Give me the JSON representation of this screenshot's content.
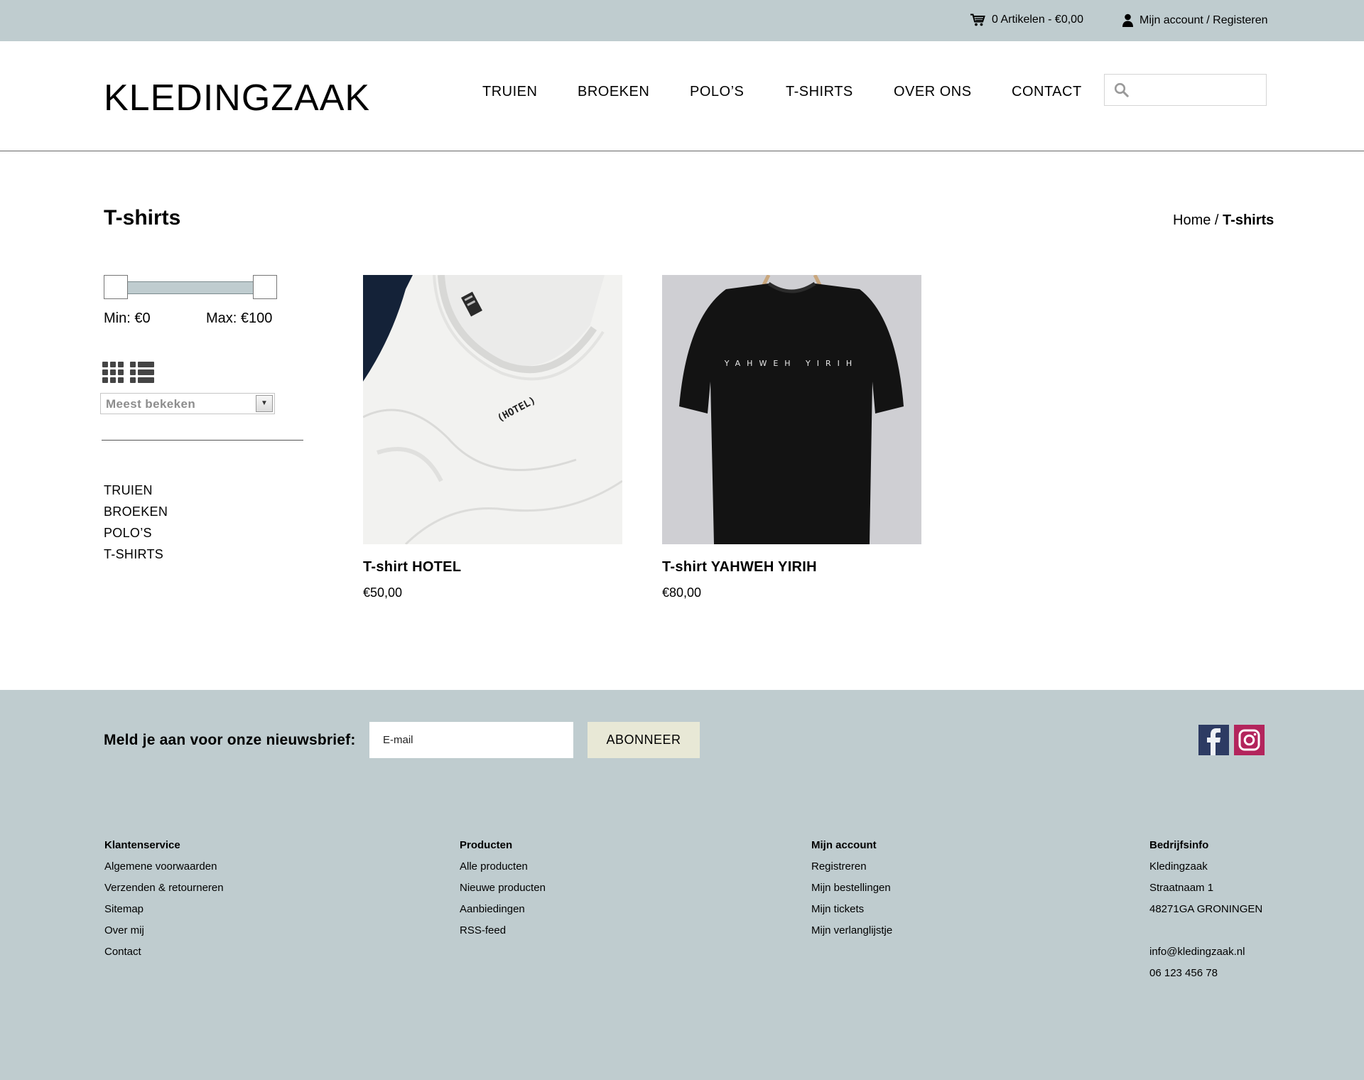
{
  "topbar": {
    "cart_label": "0 Artikelen - €0,00",
    "account_label": "Mijn account / Registeren"
  },
  "header": {
    "logo": "KLEDINGZAAK",
    "nav": [
      "TRUIEN",
      "BROEKEN",
      "POLO’S",
      "T-SHIRTS",
      "OVER ONS",
      "CONTACT"
    ],
    "search_value": ""
  },
  "page": {
    "title": "T-shirts",
    "breadcrumb": {
      "home": "Home",
      "separator": "/",
      "current": "T-shirts"
    }
  },
  "filters": {
    "price": {
      "min_label": "Min: €0",
      "max_label": "Max: €100",
      "min_value": 0,
      "max_value": 100
    },
    "sort": {
      "selected": "Meest bekeken"
    },
    "categories": [
      "TRUIEN",
      "BROEKEN",
      "POLO’S",
      "T-SHIRTS"
    ]
  },
  "products": [
    {
      "name": "T-shirt HOTEL",
      "price": "€50,00",
      "print": "(HOTEL)"
    },
    {
      "name": "T-shirt YAHWEH YIRIH",
      "price": "€80,00",
      "print": "YAHWEH YIRIH"
    }
  ],
  "footer": {
    "newsletter": {
      "label": "Meld je aan voor onze nieuwsbrief:",
      "placeholder": "E-mail",
      "button": "ABONNEER"
    },
    "columns": [
      {
        "title": "Klantenservice",
        "items": [
          "Algemene voorwaarden",
          "Verzenden & retourneren",
          "Sitemap",
          "Over mij",
          "Contact"
        ]
      },
      {
        "title": "Producten",
        "items": [
          "Alle producten",
          "Nieuwe producten",
          "Aanbiedingen",
          "RSS-feed"
        ]
      },
      {
        "title": "Mijn account",
        "items": [
          "Registreren",
          "Mijn bestellingen",
          "Mijn tickets",
          "Mijn verlanglijstje"
        ]
      },
      {
        "title": "Bedrijfsinfo",
        "items": [
          "Kledingzaak",
          "Straatnaam 1",
          "48271GA GRONINGEN",
          "",
          "info@kledingzaak.nl",
          "06 123 456 78"
        ]
      }
    ]
  },
  "colors": {
    "band": "#bfcccf",
    "subscribe_button": "#e8e8d6",
    "facebook": "#3b5998",
    "instagram": "#c13584"
  },
  "icons": [
    "cart-icon",
    "user-icon",
    "search-icon",
    "grid-view-icon",
    "list-view-icon",
    "chevron-down-icon",
    "facebook-icon",
    "instagram-icon"
  ]
}
